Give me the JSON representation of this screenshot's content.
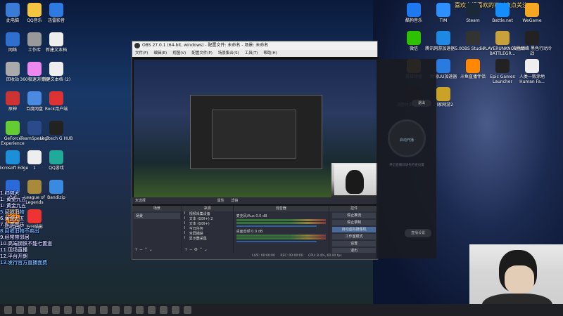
{
  "banner": {
    "text": "喜欢主播喜欢的可以点点关注"
  },
  "desktop_left": [
    {
      "label": "此电脑",
      "color": "#3a7bd5"
    },
    {
      "label": "QQ音乐",
      "color": "#f5c542"
    },
    {
      "label": "迅雷影音",
      "color": "#2d7be0"
    },
    {
      "label": "网络",
      "color": "#2f6fd0"
    },
    {
      "label": "工作库",
      "color": "#999"
    },
    {
      "label": "新建文本档",
      "color": "#eee"
    },
    {
      "label": "回收站",
      "color": "#aaa"
    },
    {
      "label": "360极速浏览器",
      "color": "#e8e"
    },
    {
      "label": "新建文本档 (2)",
      "color": "#eee"
    },
    {
      "label": "原神",
      "color": "#c33"
    },
    {
      "label": "百度网盘",
      "color": "#4a8ae0"
    },
    {
      "label": "Rock用户端",
      "color": "#d33"
    },
    {
      "label": "GeForce Experience",
      "color": "#6c3"
    },
    {
      "label": "TeamSpeak 3",
      "color": "#2a4a8a"
    },
    {
      "label": "Logitech G HUB",
      "color": "#222"
    },
    {
      "label": "Microsoft Edge",
      "color": "#1d8fd8"
    },
    {
      "label": "1",
      "color": "#eee"
    },
    {
      "label": "QQ游戏",
      "color": "#2a9"
    },
    {
      "label": "飞书",
      "color": "#2a6bd9"
    },
    {
      "label": "League of Legends",
      "color": "#a98a3a"
    },
    {
      "label": "Bandizip",
      "color": "#3a8ae0"
    },
    {
      "label": "斗鱼直播",
      "color": "#f80"
    },
    {
      "label": "万兴喵影",
      "color": "#e33"
    }
  ],
  "desktop_top_right": [
    {
      "label": "酷狗音乐",
      "color": "#1e79f0"
    },
    {
      "label": "TIM",
      "color": "#2e90ff"
    },
    {
      "label": "Steam",
      "color": "#1b2838"
    },
    {
      "label": "Battle.net",
      "color": "#148eff"
    },
    {
      "label": "WeGame",
      "color": "#f5a623"
    },
    {
      "label": "微信",
      "color": "#2dc100"
    },
    {
      "label": "腾讯网游加速器5.0",
      "color": "#1e88e5"
    },
    {
      "label": "OBS Studio",
      "color": "#333"
    },
    {
      "label": "PLAYERUNKNOWN'S BATTLEGR...",
      "color": "#c8a13a"
    },
    {
      "label": "决胜巅峰 黑色行动冷战",
      "color": "#222"
    },
    {
      "label": "英雄联盟",
      "color": "#c9a227"
    },
    {
      "label": "网易UU加速器",
      "color": "#2a7be0"
    },
    {
      "label": "斗鱼直播伴侣",
      "color": "#f80"
    },
    {
      "label": "Epic Games Launcher",
      "color": "#222"
    },
    {
      "label": "人类一败涂地 Human Fa...",
      "color": "#eee"
    },
    {
      "label": "决胜时刻 现代战争",
      "color": "#222"
    },
    {
      "label": "川家网游2",
      "color": "#c9a227"
    }
  ],
  "obs": {
    "title": "OBS 27.0.1 (64-bit, windows) - 配置文件: 未命名 - 场景: 未命名",
    "menu": [
      "文件(F)",
      "编辑(E)",
      "视图(V)",
      "配置文件(P)",
      "场景集合(S)",
      "工具(T)",
      "帮助(H)"
    ],
    "no_source": "未选择",
    "props": "属性",
    "filters": "滤镜",
    "docks": {
      "scenes": "场景",
      "sources": "来源",
      "mixer": "混音器",
      "controls": "控件"
    },
    "scene_items": [
      "场景"
    ],
    "source_items": [
      "视频采集设备",
      "文本 (GDI+) 2",
      "文本 (GDI+)",
      "今日任务",
      "全屏捕获",
      "显示器采集"
    ],
    "mixer": [
      {
        "name": "麦克风/Aux",
        "db": "0.0 dB"
      },
      {
        "name": "桌面音频",
        "db": "0.0 dB"
      }
    ],
    "controls": [
      "停止推流",
      "停止录制",
      "启动虚拟摄像机",
      "工作室模式",
      "设置",
      "退出"
    ],
    "status": {
      "live": "LIVE: 00:00:00",
      "rec": "REC: 00:00:00",
      "cpu": "CPU: 8.4%, 60.00 fps"
    }
  },
  "live_panel": {
    "exit": "退出",
    "start": "启动开播",
    "tip": "开启直播前请先检查设置",
    "setup": "直播设置"
  },
  "chat": [
    {
      "text": "1.红包大",
      "hl": false
    },
    {
      "text": "1: 黄金九五",
      "hl": false
    },
    {
      "text": "1: 黄金九五",
      "hl": false
    },
    {
      "text": "5.回收旧物",
      "hl": true
    },
    {
      "text": "6.黄金九五",
      "hl": false
    },
    {
      "text": "7.私享音乐",
      "hl": false
    },
    {
      "text": "8.回收旧物不卖出",
      "hl": true
    },
    {
      "text": "9.经常带邻居",
      "hl": false
    },
    {
      "text": "10.高端钢铁不能七置道",
      "hl": false
    },
    {
      "text": "11.现场直播",
      "hl": false
    },
    {
      "text": "12.平台开朗",
      "hl": false
    },
    {
      "text": "13.发行官方直播面费",
      "hl": true
    }
  ],
  "taskbar_icons": [
    "windows",
    "search",
    "taskview",
    "explorer",
    "steam",
    "netease",
    "qq",
    "obs",
    "qq-music",
    "chrome",
    "store",
    "wechat",
    "douyu",
    "edge",
    "folder",
    "settings"
  ]
}
